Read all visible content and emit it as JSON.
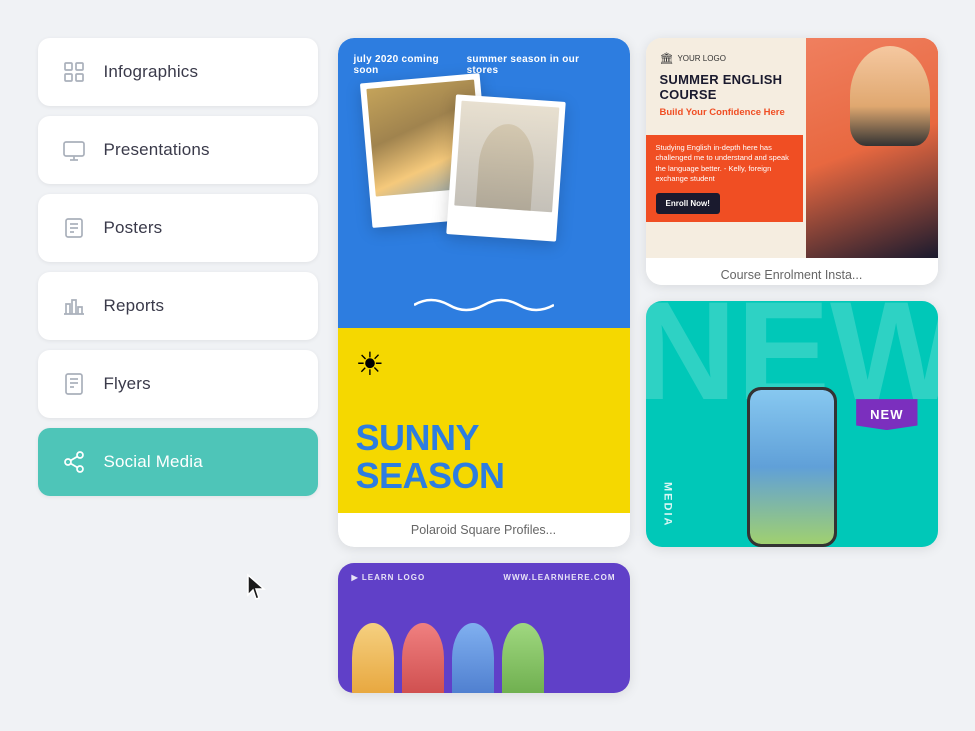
{
  "sidebar": {
    "items": [
      {
        "id": "infographics",
        "label": "Infographics",
        "active": false
      },
      {
        "id": "presentations",
        "label": "Presentations",
        "active": false
      },
      {
        "id": "posters",
        "label": "Posters",
        "active": false
      },
      {
        "id": "reports",
        "label": "Reports",
        "active": false
      },
      {
        "id": "flyers",
        "label": "Flyers",
        "active": false
      },
      {
        "id": "social-media",
        "label": "Social Media",
        "active": true
      }
    ]
  },
  "cards": [
    {
      "id": "story",
      "header_left": "july 2020 coming soon",
      "header_right": "summer season in our stores",
      "sunny_label": "SUNNY SEASON",
      "caption": "Polaroid Square Profiles..."
    },
    {
      "id": "course",
      "logo_text": "YOUR LOGO",
      "title": "Summer ENGLISH COURSE",
      "subtitle": "Build Your Confidence Here",
      "body_text": "Studying English in-depth here has challenged me to understand and speak the language better. - Kelly, foreign exchange student",
      "enroll_label": "Enroll Now!",
      "caption": "Course Enrolment Insta..."
    },
    {
      "id": "social",
      "badge": "NEW",
      "vertical_text": "MEDIA"
    },
    {
      "id": "learn",
      "top_left": "▶ LEARN LOGO",
      "top_right": "WWW.LEARNHERE.COM"
    }
  ],
  "colors": {
    "accent_teal": "#4ec5b8",
    "story_blue": "#2d7de0",
    "story_yellow": "#f5d800",
    "course_orange": "#f04e23",
    "social_cyan": "#00c8b8",
    "learn_purple": "#6040c8"
  }
}
